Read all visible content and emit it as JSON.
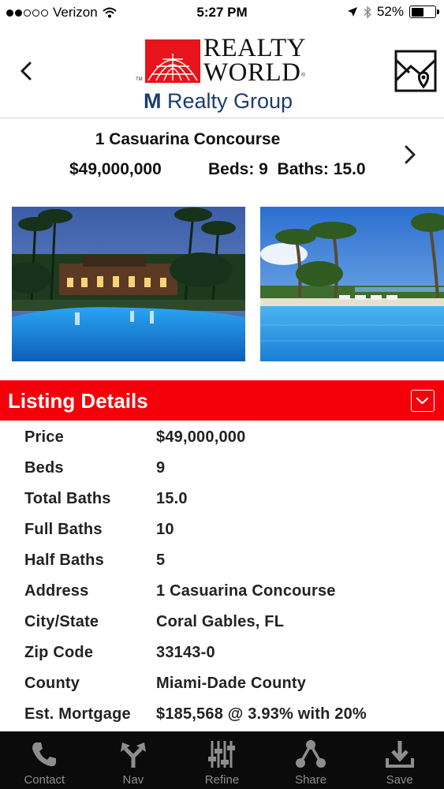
{
  "status_bar": {
    "carrier": "Verizon",
    "time": "5:27 PM",
    "battery_text": "52%",
    "battery_level": 0.52,
    "signal_bars_filled": 2,
    "signal_bars_total": 5
  },
  "header": {
    "logo_line1": "REALTY",
    "logo_line2": "WORLD",
    "logo_tm": "TM",
    "logo_reg": "®",
    "logo_sub_m": "M",
    "logo_sub_rest": " Realty Group",
    "brand_color": "#e8141b",
    "back_icon": "chevron-left-icon",
    "map_icon": "map-pin-icon"
  },
  "summary": {
    "address": "1 Casuarina Concourse",
    "price": "$49,000,000",
    "beds_baths": "Beds: 9  Baths: 15.0",
    "next_icon": "chevron-right-icon"
  },
  "photos": [
    {
      "description_icon": "property-photo-villa-pool"
    },
    {
      "description_icon": "property-photo-palm-pool"
    }
  ],
  "listing_details": {
    "title": "Listing Details",
    "accent_color": "#f5000a",
    "collapse_icon": "chevron-down-icon",
    "rows": [
      {
        "label": "Price",
        "value": "$49,000,000"
      },
      {
        "label": "Beds",
        "value": "9"
      },
      {
        "label": "Total Baths",
        "value": "15.0"
      },
      {
        "label": "Full Baths",
        "value": "10"
      },
      {
        "label": "Half Baths",
        "value": "5"
      },
      {
        "label": "Address",
        "value": "1 Casuarina Concourse"
      },
      {
        "label": "City/State",
        "value": "Coral Gables, FL"
      },
      {
        "label": "Zip Code",
        "value": "33143-0"
      },
      {
        "label": "County",
        "value": "Miami-Dade County"
      },
      {
        "label": "Est. Mortgage",
        "value": "$185,568 @ 3.93% with 20%"
      }
    ]
  },
  "tab_bar": {
    "tabs": [
      {
        "label": "Contact",
        "icon": "phone-icon"
      },
      {
        "label": "Nav",
        "icon": "navigation-arrows-icon"
      },
      {
        "label": "Refine",
        "icon": "sliders-icon"
      },
      {
        "label": "Share",
        "icon": "share-icon"
      },
      {
        "label": "Save",
        "icon": "download-icon"
      }
    ]
  }
}
